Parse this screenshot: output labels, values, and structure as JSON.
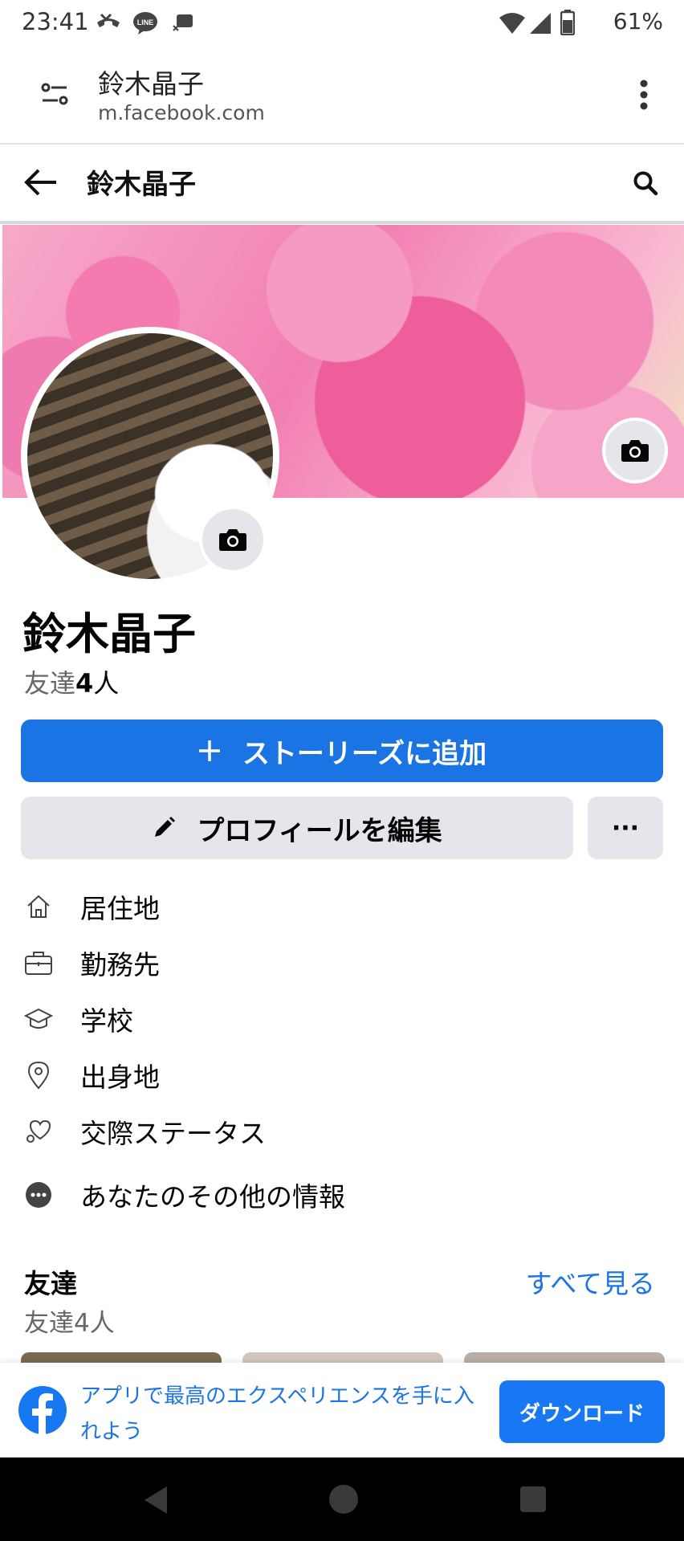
{
  "status_bar": {
    "time": "23:41",
    "battery": "61%",
    "icons": [
      "missed-call-icon",
      "line-icon",
      "notification-icon",
      "wifi-icon",
      "signal-icon",
      "battery-icon"
    ]
  },
  "browser": {
    "page_title": "鈴木晶子",
    "url": "m.facebook.com"
  },
  "header": {
    "title": "鈴木晶子"
  },
  "profile": {
    "name": "鈴木晶子",
    "friends_label": "友達",
    "friends_count": "4",
    "friends_unit": "人"
  },
  "actions": {
    "add_story": "ストーリーズに追加",
    "edit_profile": "プロフィールを編集",
    "more": "···"
  },
  "info": [
    {
      "label": "居住地",
      "icon": "home-icon"
    },
    {
      "label": "勤務先",
      "icon": "briefcase-icon"
    },
    {
      "label": "学校",
      "icon": "graduation-cap-icon"
    },
    {
      "label": "出身地",
      "icon": "location-pin-icon"
    },
    {
      "label": "交際ステータス",
      "icon": "heart-icon"
    },
    {
      "label": "あなたのその他の情報",
      "icon": "more-circle-icon"
    }
  ],
  "friends_section": {
    "title": "友達",
    "see_all": "すべて見る",
    "count_text": "友達4人"
  },
  "app_promo": {
    "text": "アプリで最高のエクスペリエンスを手に入れよう",
    "download": "ダウンロード"
  },
  "colors": {
    "accent": "#1b74e4",
    "button_gray": "#e4e6eb",
    "secondary_text": "#65676b"
  }
}
